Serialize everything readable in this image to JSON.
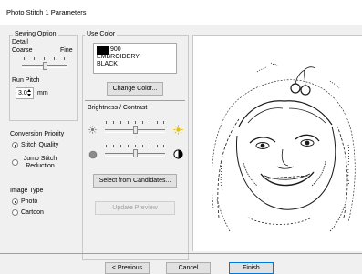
{
  "window": {
    "title": "Photo Stitch 1 Parameters"
  },
  "sewing_option": {
    "group_label": "Sewing Option",
    "detail_label": "Detail",
    "detail_min": "Coarse",
    "detail_max": "Fine",
    "detail_level": 0.5,
    "run_pitch_label": "Run Pitch",
    "run_pitch_value": "3.0",
    "run_pitch_unit": "mm"
  },
  "conversion_priority": {
    "label": "Conversion Priority",
    "options": [
      "Stitch Quality",
      "Jump Stitch Reduction"
    ],
    "selected": "Stitch Quality"
  },
  "image_type": {
    "label": "Image Type",
    "options": [
      "Photo",
      "Cartoon"
    ],
    "selected": "Photo"
  },
  "use_color": {
    "group_label": "Use Color",
    "color_code": "900",
    "color_line1": "EMBROIDERY",
    "color_line2": "BLACK",
    "swatch": "#000000",
    "change_button": "Change Color..."
  },
  "brightness_contrast": {
    "label": "Brightness / Contrast",
    "brightness_level": 0.5,
    "contrast_level": 0.5
  },
  "buttons": {
    "select_candidates": "Select from Candidates...",
    "update_preview": "Update Preview",
    "previous": "< Previous",
    "cancel": "Cancel",
    "finish": "Finish"
  }
}
